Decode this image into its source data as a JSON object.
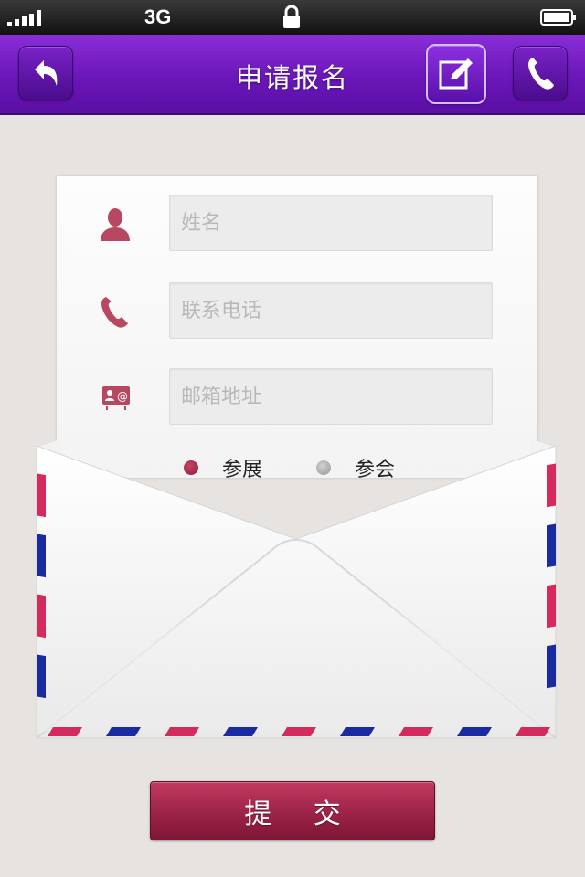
{
  "status_bar": {
    "carrier": "3G",
    "icons": [
      "signal-icon",
      "lock-icon",
      "battery-icon"
    ]
  },
  "nav": {
    "title": "申请报名",
    "back_icon": "back-arrow-icon",
    "edit_icon": "edit-icon",
    "phone_icon": "phone-icon"
  },
  "form": {
    "name": {
      "value": "",
      "placeholder": "姓名",
      "icon": "person-icon"
    },
    "phone": {
      "value": "",
      "placeholder": "联系电话",
      "icon": "phone-icon"
    },
    "email": {
      "value": "",
      "placeholder": "邮箱地址",
      "icon": "contact-email-icon"
    },
    "attendance": {
      "options": [
        {
          "label": "参展",
          "selected": true
        },
        {
          "label": "参会",
          "selected": false
        }
      ]
    }
  },
  "submit_label": "提 交",
  "colors": {
    "nav_purple": "#6a16b8",
    "accent_red": "#a0244a",
    "airmail_red": "#d42a5e",
    "airmail_blue": "#1a2aa0"
  }
}
